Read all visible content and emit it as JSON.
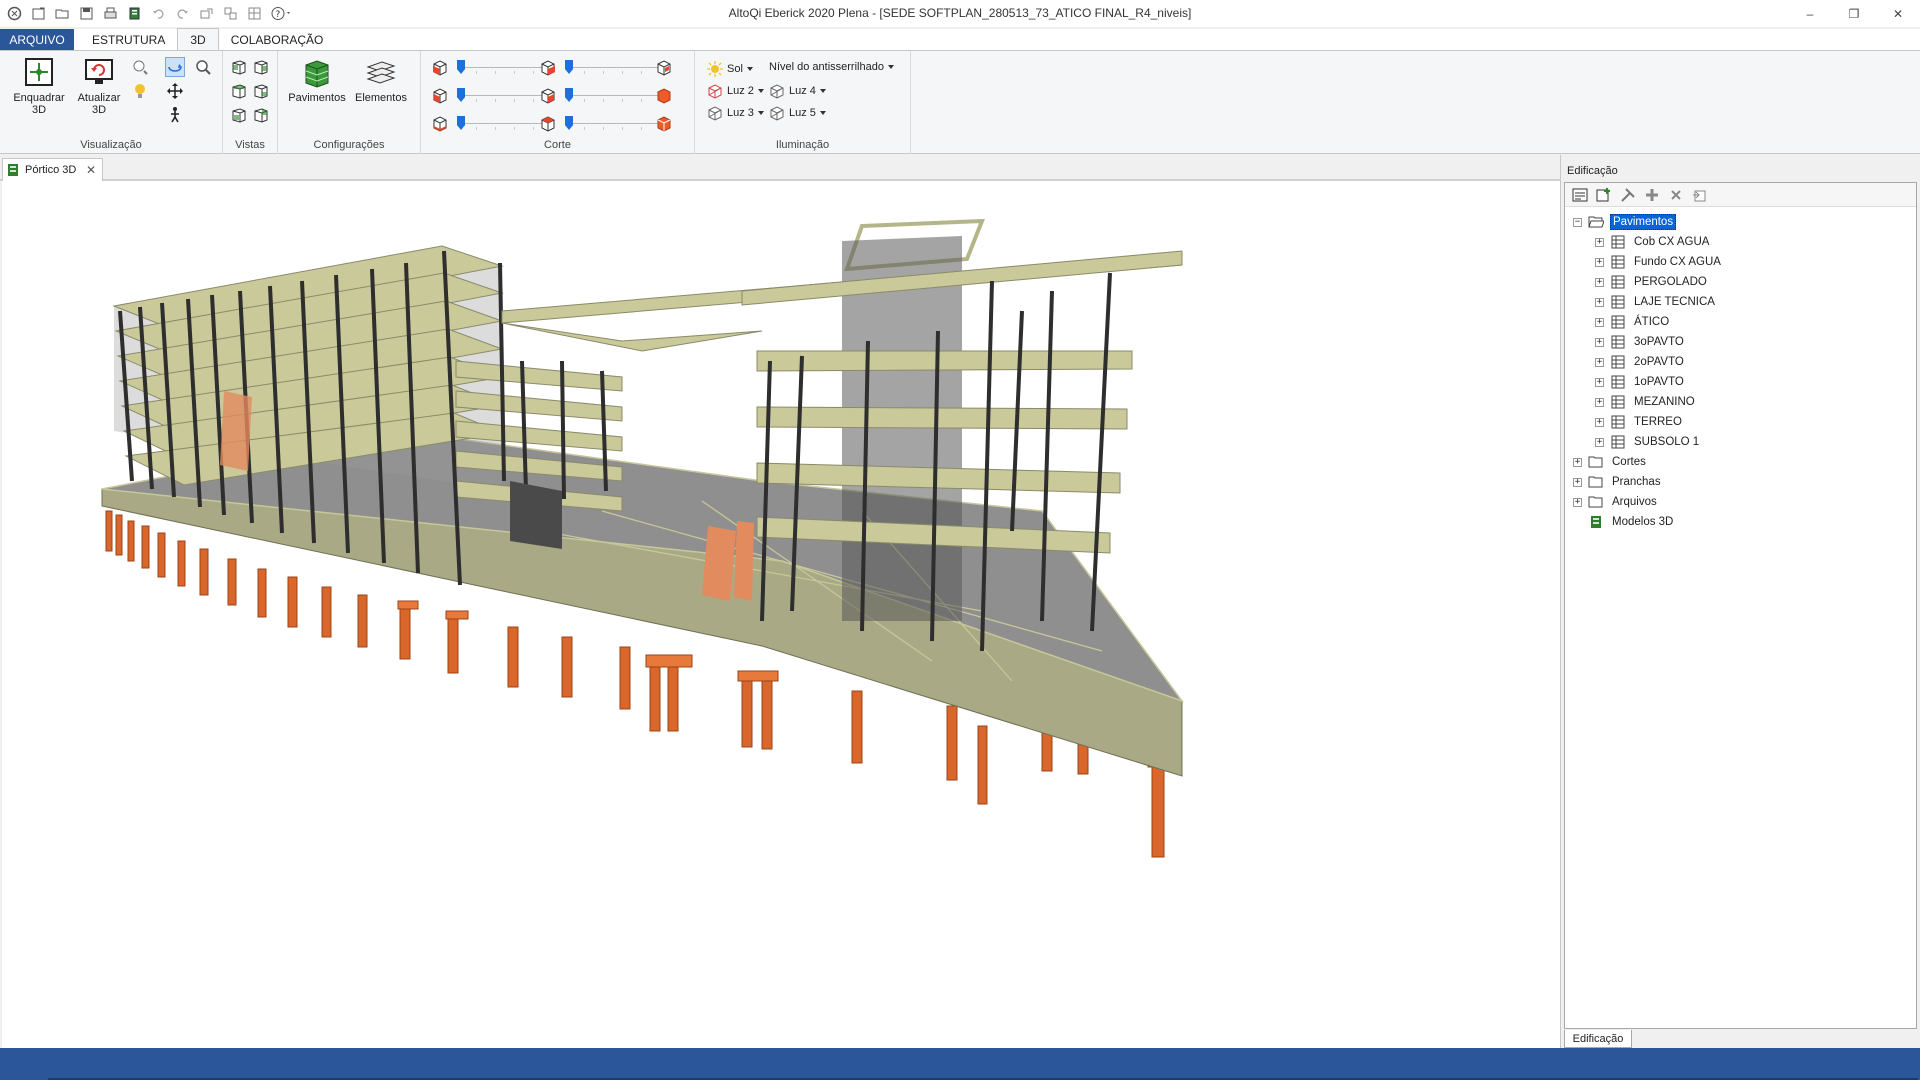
{
  "window": {
    "title": "AltoQi Eberick 2020 Plena - [SEDE SOFTPLAN_280513_73_ATICO FINAL_R4_niveis]",
    "minimize_glyph": "–",
    "restore_glyph": "❐",
    "close_glyph": "✕"
  },
  "quick_access": {
    "icons": [
      "app-icon",
      "new-icon",
      "open-icon",
      "save-icon",
      "print-icon",
      "export-icon",
      "undo-icon",
      "redo-icon",
      "tool-1-icon",
      "tool-2-icon",
      "tool-3-icon",
      "help-icon"
    ]
  },
  "ribbon_tabs": [
    {
      "label": "ARQUIVO"
    },
    {
      "label": "ESTRUTURA"
    },
    {
      "label": "3D"
    },
    {
      "label": "COLABORAÇÃO"
    }
  ],
  "ribbon": {
    "visualizacao": {
      "label": "Visualização",
      "enquadrar_line1": "Enquadrar",
      "enquadrar_line2": "3D",
      "atualizar_line1": "Atualizar",
      "atualizar_line2": "3D"
    },
    "vistas": {
      "label": "Vistas"
    },
    "configuracoes": {
      "label": "Configurações",
      "pavimentos": "Pavimentos",
      "elementos": "Elementos"
    },
    "corte": {
      "label": "Corte",
      "slider_values": [
        0.0,
        0.0,
        0.0,
        0.0,
        0.0,
        0.0
      ]
    },
    "iluminacao": {
      "label": "Iluminação",
      "sol": "Sol",
      "antialias": "Nível do antisserrilhado",
      "luz2": "Luz 2",
      "luz3": "Luz 3",
      "luz4": "Luz 4",
      "luz5": "Luz 5"
    }
  },
  "document_tab": {
    "label": "Pórtico 3D",
    "close_glyph": "✕"
  },
  "panel": {
    "title": "Edificação",
    "bottom_tab": "Edificação",
    "tree": {
      "root": "Pavimentos",
      "floors": [
        "Cob CX AGUA",
        "Fundo CX AGUA",
        "PERGOLADO",
        "LAJE TECNICA",
        "ÁTICO",
        "3oPAVTO",
        "2oPAVTO",
        "1oPAVTO",
        "MEZANINO",
        "TERREO",
        "SUBSOLO 1"
      ],
      "folders": [
        "Cortes",
        "Pranchas",
        "Arquivos"
      ],
      "models": "Modelos 3D"
    }
  },
  "colors": {
    "accent": "#2b579a",
    "beam": "#c9c99a",
    "column": "#3c3c3c",
    "slab": "#8a8a8a",
    "pile": "#d9662b",
    "selection": "#0a64d6"
  }
}
